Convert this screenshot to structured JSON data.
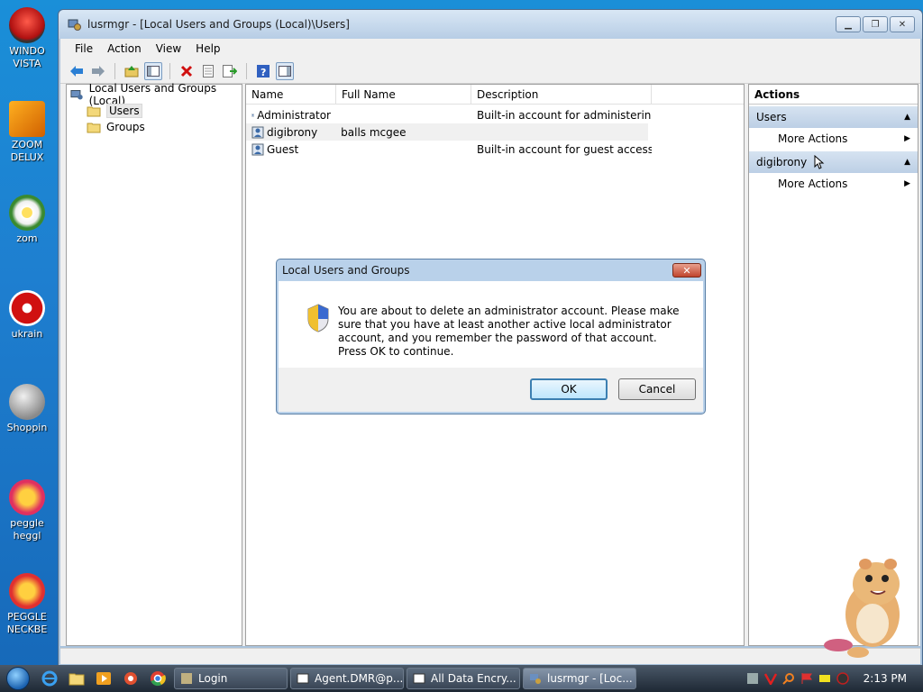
{
  "desktop_icons": [
    {
      "label_1": "WINDO",
      "label_2": "VISTA"
    },
    {
      "label_1": "ZOOM",
      "label_2": "DELUX"
    },
    {
      "label_1": "zom",
      "label_2": ""
    },
    {
      "label_1": "ukrain",
      "label_2": ""
    },
    {
      "label_1": "Shoppin",
      "label_2": ""
    },
    {
      "label_1": "peggle",
      "label_2": "heggl"
    },
    {
      "label_1": "PEGGLE",
      "label_2": "NECKBE"
    }
  ],
  "window": {
    "title": "lusrmgr - [Local Users and Groups (Local)\\Users]",
    "menu": [
      "File",
      "Action",
      "View",
      "Help"
    ]
  },
  "tree": {
    "root": "Local Users and Groups (Local)",
    "children": [
      "Users",
      "Groups"
    ]
  },
  "list": {
    "columns": [
      "Name",
      "Full Name",
      "Description"
    ],
    "rows": [
      {
        "name": "Administrator",
        "full_name": "",
        "description": "Built-in account for administering..."
      },
      {
        "name": "digibrony",
        "full_name": "balls mcgee",
        "description": ""
      },
      {
        "name": "Guest",
        "full_name": "",
        "description": "Built-in account for guest access t..."
      }
    ]
  },
  "actions": {
    "title": "Actions",
    "sections": [
      {
        "label": "Users",
        "item": "More Actions"
      },
      {
        "label": "digibrony",
        "item": "More Actions"
      }
    ]
  },
  "dialog": {
    "title": "Local Users and Groups",
    "message": "You are about to delete an administrator account. Please make sure that you have at least another active local administrator account, and you remember the password of that account. Press OK to continue.",
    "ok_label": "OK",
    "cancel_label": "Cancel"
  },
  "taskbar": {
    "tasks": [
      "Login",
      "Agent.DMR@p...",
      "All Data Encry...",
      "lusrmgr - [Loc..."
    ],
    "clock": "2:13 PM"
  },
  "colors": {
    "desktop": "#1e7fd0",
    "dialog_frame": "#b9d1ea",
    "action_header": "#bccfe5"
  }
}
